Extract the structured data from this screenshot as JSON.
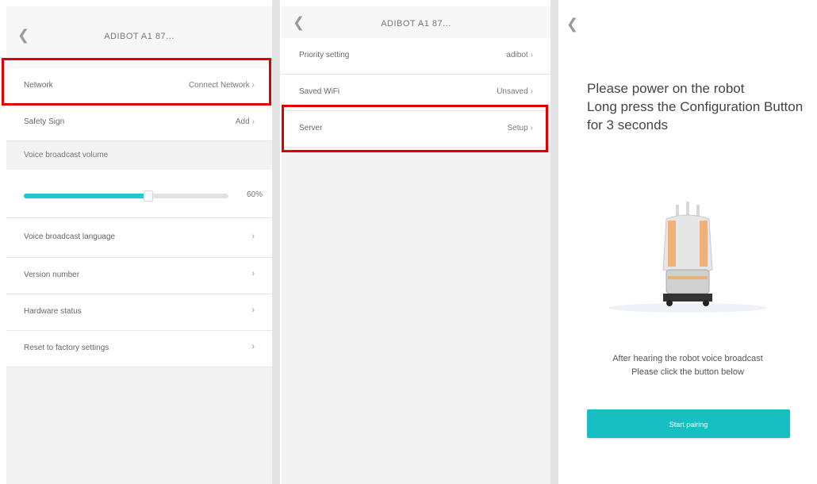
{
  "panel1": {
    "back_icon": "chevron-left-icon",
    "title": "ADIBOT A1 87...",
    "rows": {
      "network": {
        "label": "Network",
        "value": "Connect Network"
      },
      "safety": {
        "label": "Safety Sign",
        "value": "Add"
      },
      "voice_volume_header": "Voice broadcast volume",
      "volume_percent": "60%",
      "volume_level": 0.6,
      "voice_language": {
        "label": "Voice broadcast language"
      },
      "version": {
        "label": "Version number"
      },
      "hardware": {
        "label": "Hardware status"
      },
      "reset": {
        "label": "Reset to factory settings"
      }
    }
  },
  "panel2": {
    "back_icon": "chevron-left-icon",
    "title": "ADIBOT A1 87...",
    "rows": {
      "priority": {
        "label": "Priority setting",
        "value": "adibot"
      },
      "saved_wifi": {
        "label": "Saved WiFi",
        "value": "Unsaved"
      },
      "server": {
        "label": "Server",
        "value": "Setup"
      }
    }
  },
  "panel3": {
    "back_icon": "chevron-left-icon",
    "instruction_line1": "Please power on the robot",
    "instruction_line2": "Long press the Configuration Button for 3 seconds",
    "after_line1": "After hearing the robot voice broadcast",
    "after_line2": "Please click the button below",
    "button_label": "Start pairing",
    "robot_image_icon": "robot-illustration"
  },
  "colors": {
    "accent": "#1fc9d3",
    "highlight": "#e00000",
    "button": "#17bfc3"
  }
}
